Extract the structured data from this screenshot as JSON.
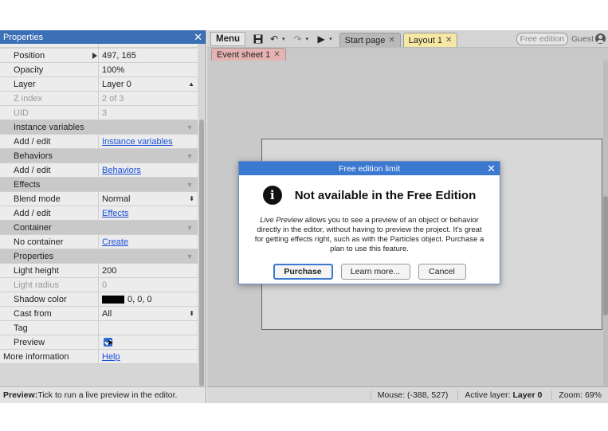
{
  "properties_panel": {
    "title": "Properties",
    "rows": [
      {
        "key": "Position",
        "value": "497, 165"
      },
      {
        "key": "Opacity",
        "value": "100%"
      },
      {
        "key": "Layer",
        "value": "Layer 0"
      },
      {
        "key": "Z index",
        "value": "2 of 3"
      },
      {
        "key": "UID",
        "value": "3"
      },
      {
        "section": "Instance variables"
      },
      {
        "key": "Add / edit",
        "link": "Instance variables"
      },
      {
        "section": "Behaviors"
      },
      {
        "key": "Add / edit",
        "link": "Behaviors"
      },
      {
        "section": "Effects"
      },
      {
        "key": "Blend mode",
        "value": "Normal"
      },
      {
        "key": "Add / edit",
        "link": "Effects"
      },
      {
        "section": "Container"
      },
      {
        "key": "No container",
        "link": "Create"
      },
      {
        "section": "Properties"
      },
      {
        "key": "Light height",
        "value": "200"
      },
      {
        "key": "Light radius",
        "value": "0"
      },
      {
        "key": "Shadow color",
        "value": "0, 0, 0"
      },
      {
        "key": "Cast from",
        "value": "All"
      },
      {
        "key": "Tag",
        "value": ""
      },
      {
        "key": "Preview",
        "checked": true
      },
      {
        "key": "More information",
        "link": "Help"
      }
    ],
    "status_bold": "Preview:",
    "status_text": " Tick to run a live preview in the editor."
  },
  "toolbar": {
    "menu": "Menu",
    "tabs": [
      "Start page",
      "Layout 1"
    ],
    "free_edition_badge": "Free edition",
    "user": "Guest"
  },
  "subtabs": [
    "Event sheet 1"
  ],
  "editor_status": {
    "mouse": "Mouse: (-388, 527)",
    "active_layer_label": "Active layer: ",
    "active_layer": "Layer 0",
    "zoom": "Zoom: 69%"
  },
  "modal": {
    "title": "Free edition limit",
    "heading": "Not available in the Free Edition",
    "message_italic": "Live Preview",
    "message": " allows you to see a preview of an object or behavior directly in the editor, without having to preview the project. It's great for getting effects right, such as with the Particles object. Purchase a plan to use this feature.",
    "buttons": {
      "purchase": "Purchase",
      "learn": "Learn more...",
      "cancel": "Cancel"
    }
  }
}
